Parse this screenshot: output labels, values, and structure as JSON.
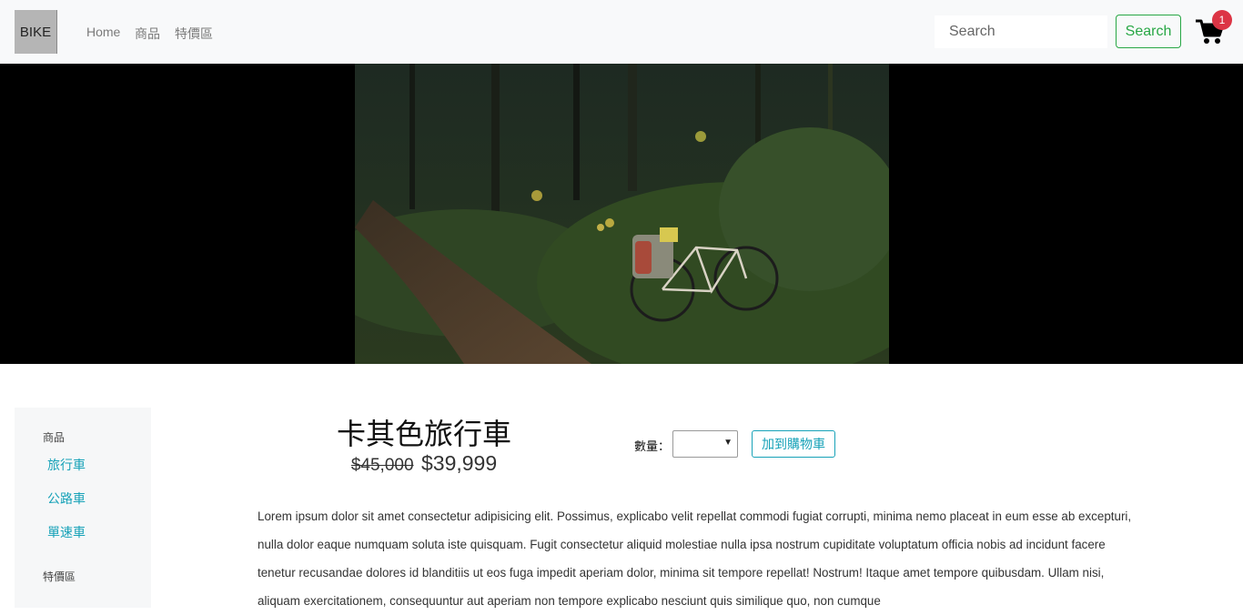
{
  "navbar": {
    "brand": "BIKE",
    "links": [
      "Home",
      "商品",
      "特價區"
    ],
    "search_placeholder": "Search",
    "search_button": "Search",
    "cart_count": "1"
  },
  "sidebar": {
    "section1": "商品",
    "items": [
      "旅行車",
      "公路車",
      "單速車"
    ],
    "section2": "特價區"
  },
  "product": {
    "title": "卡其色旅行車",
    "price_old": "$45,000",
    "price_new": "$39,999",
    "qty_label": "數量：",
    "add_to_cart": "加到購物車",
    "description": "Lorem ipsum dolor sit amet consectetur adipisicing elit. Possimus, explicabo velit repellat commodi fugiat corrupti, minima nemo placeat in eum esse ab excepturi, nulla dolor eaque numquam soluta iste quisquam. Fugit consectetur aliquid molestiae nulla ipsa nostrum cupiditate voluptatum officia nobis ad incidunt facere tenetur recusandae dolores id blanditiis ut eos fuga impedit aperiam dolor, minima sit tempore repellat! Nostrum! Itaque amet tempore quibusdam. Ullam nisi, aliquam exercitationem, consequuntur aut aperiam non tempore explicabo nesciunt quis similique quo, non cumque"
  },
  "colors": {
    "accent_green": "#28a745",
    "accent_teal": "#17a2b8",
    "badge_red": "#dc3545"
  },
  "icons": [
    "shopping-cart-icon",
    "select-caret-icon"
  ]
}
